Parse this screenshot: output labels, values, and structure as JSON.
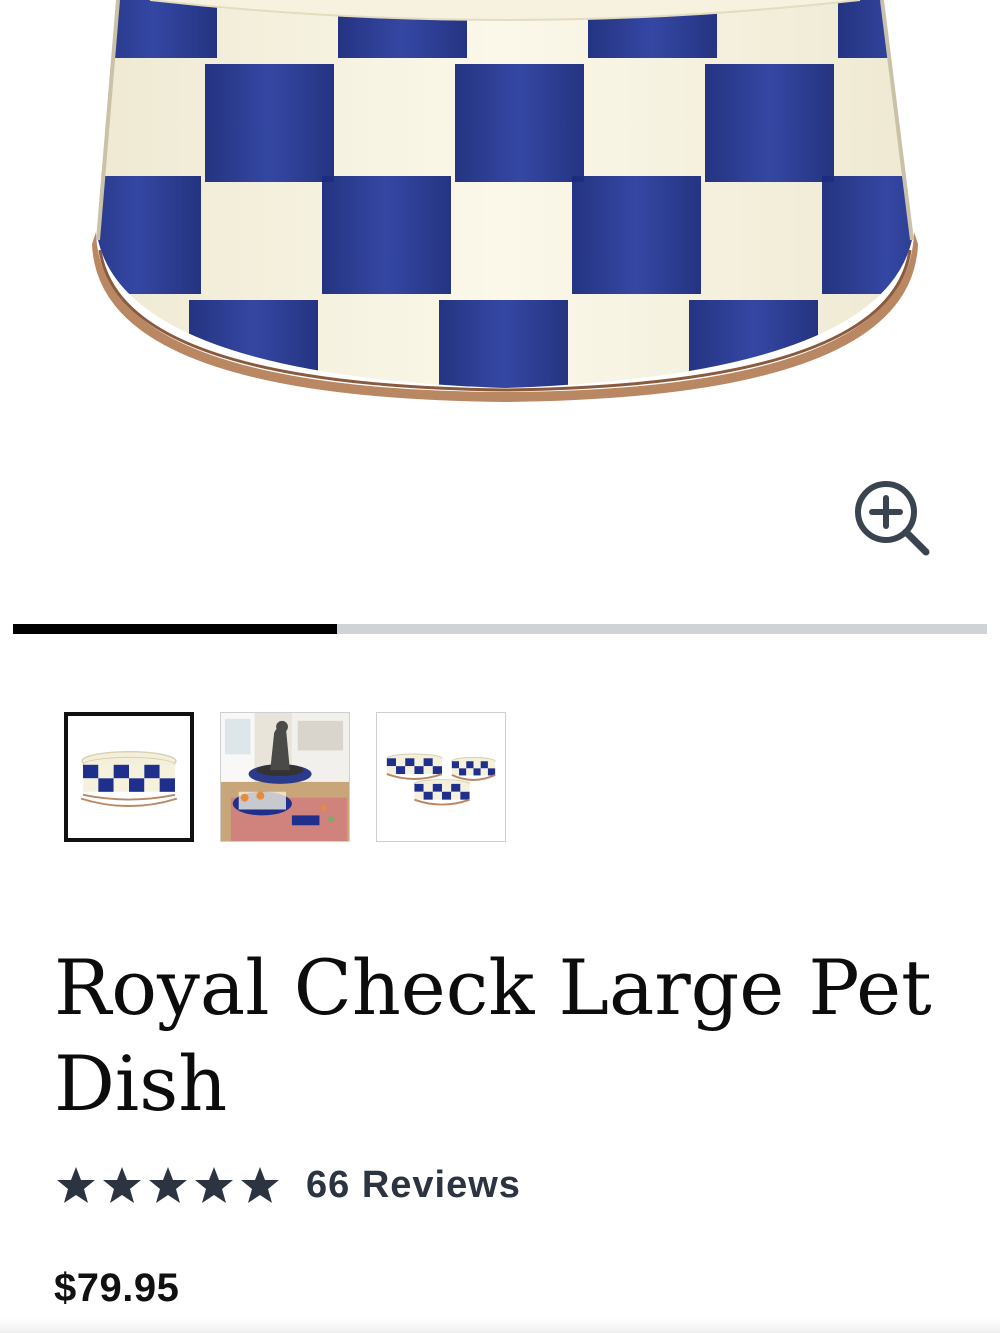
{
  "product": {
    "title": "Royal Check Large Pet Dish",
    "reviews_label": "66 Reviews",
    "rating": 5,
    "rating_max": 5,
    "price": "$79.95"
  },
  "gallery": {
    "image_count": 3,
    "active_index": 0,
    "progress_fraction": 0.333,
    "thumbnails": [
      {
        "alt": "Royal Check Large Pet Dish"
      },
      {
        "alt": "Dog with checked pet beds"
      },
      {
        "alt": "Set of three pet dishes"
      }
    ]
  },
  "icons": {
    "zoom": "zoom-in-icon",
    "star": "star-icon"
  },
  "colors": {
    "check_blue": "#1f2f8c",
    "cream": "#f5f1dd",
    "copper": "#b07b55",
    "progress_active": "#000000",
    "progress_track": "#cfd3d6",
    "rating_text": "#2b3440"
  }
}
